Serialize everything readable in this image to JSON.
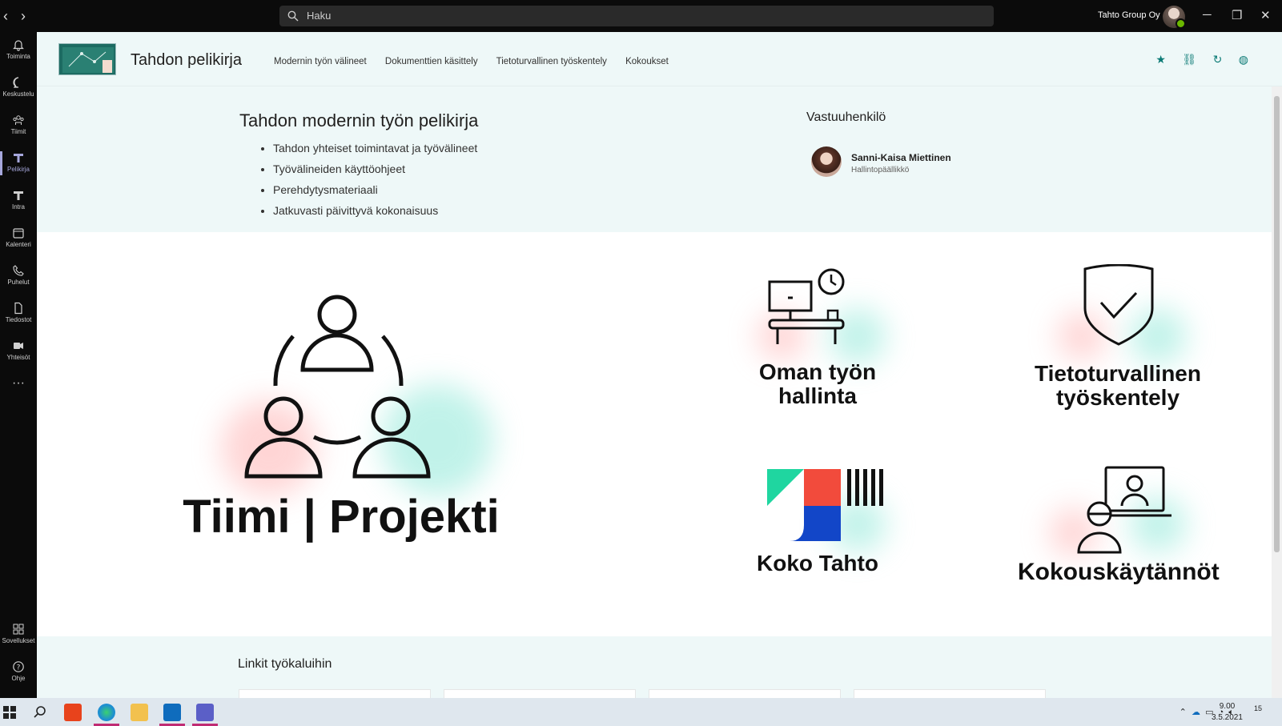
{
  "topbar": {
    "search_placeholder": "Haku",
    "org_name": "Tahto Group Oy"
  },
  "rail": [
    {
      "label": "Toiminta",
      "icon": "bell-icon"
    },
    {
      "label": "Keskustelu",
      "icon": "chat-icon"
    },
    {
      "label": "Tiimit",
      "icon": "teams-icon"
    },
    {
      "label": "Pelikirja",
      "icon": "app-t-icon",
      "active": true
    },
    {
      "label": "Intra",
      "icon": "app-t-icon"
    },
    {
      "label": "Kalenteri",
      "icon": "calendar-icon"
    },
    {
      "label": "Puhelut",
      "icon": "phone-icon"
    },
    {
      "label": "Tiedostot",
      "icon": "file-icon"
    },
    {
      "label": "Yhteisöt",
      "icon": "communities-icon"
    }
  ],
  "rail_bottom": [
    {
      "label": "Sovellukset",
      "icon": "apps-icon"
    },
    {
      "label": "Ohje",
      "icon": "help-icon"
    }
  ],
  "header": {
    "site_title": "Tahdon pelikirja",
    "nav": [
      "Modernin työn välineet",
      "Dokumenttien käsittely",
      "Tietoturvallinen työskentely",
      "Kokoukset"
    ]
  },
  "hero": {
    "title": "Tahdon modernin työn pelikirja",
    "bullets": [
      "Tahdon yhteiset toimintavat ja työvälineet",
      "Työvälineiden käyttöohjeet",
      "Perehdytysmateriaali",
      "Jatkuvasti päivittyvä kokonaisuus"
    ],
    "responsible_title": "Vastuuhenkilö",
    "person_name": "Sanni-Kaisa Miettinen",
    "person_role": "Hallintopäällikkö"
  },
  "tiles": {
    "team_project": "Tiimi | Projekti",
    "own_work_line1": "Oman työn",
    "own_work_line2": "hallinta",
    "security_line1": "Tietoturvallinen",
    "security_line2": "työskentely",
    "koko_tahto": "Koko Tahto",
    "meetings": "Kokouskäytännöt"
  },
  "links": {
    "title": "Linkit työkaluihin"
  },
  "taskbar": {
    "time": "9.00",
    "date": "3.5.2021",
    "notif_count": "15"
  },
  "colors": {
    "accent_teal": "#0b7a75",
    "band_bg": "#eef8f8",
    "rail_active": "#a6a7dc"
  }
}
